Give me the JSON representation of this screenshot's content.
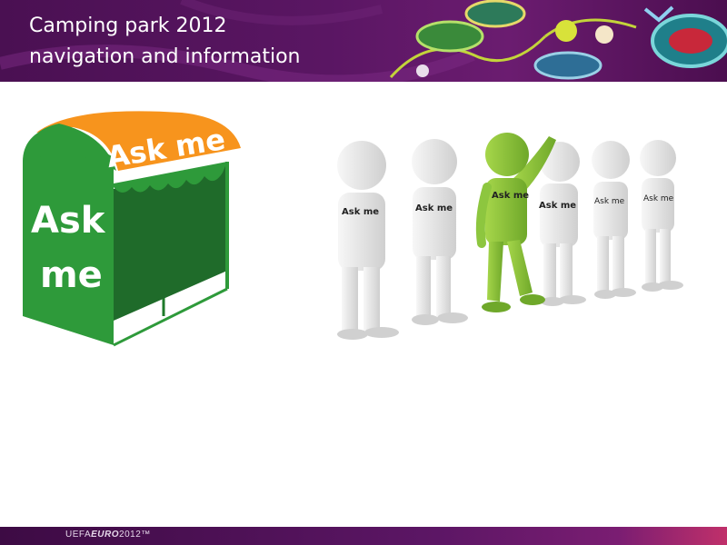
{
  "header": {
    "title_line1": "Camping park 2012",
    "title_line2": "navigation and information",
    "background_color": "#5a1663"
  },
  "tent": {
    "roof_text": "Ask me",
    "side_text_line1": "Ask",
    "side_text_line2": "me",
    "roof_color": "#f7941d",
    "body_color": "#2e9a3a"
  },
  "people": {
    "labels": [
      "Ask me",
      "Ask me",
      "Ask me",
      "Ask me",
      "Ask me",
      "Ask me"
    ],
    "highlight_color": "#8dc63f",
    "figure_color": "#e9e9e9"
  },
  "footer": {
    "brand_prefix": "UEFA",
    "brand_main": "EURO",
    "brand_suffix": "2012™"
  }
}
